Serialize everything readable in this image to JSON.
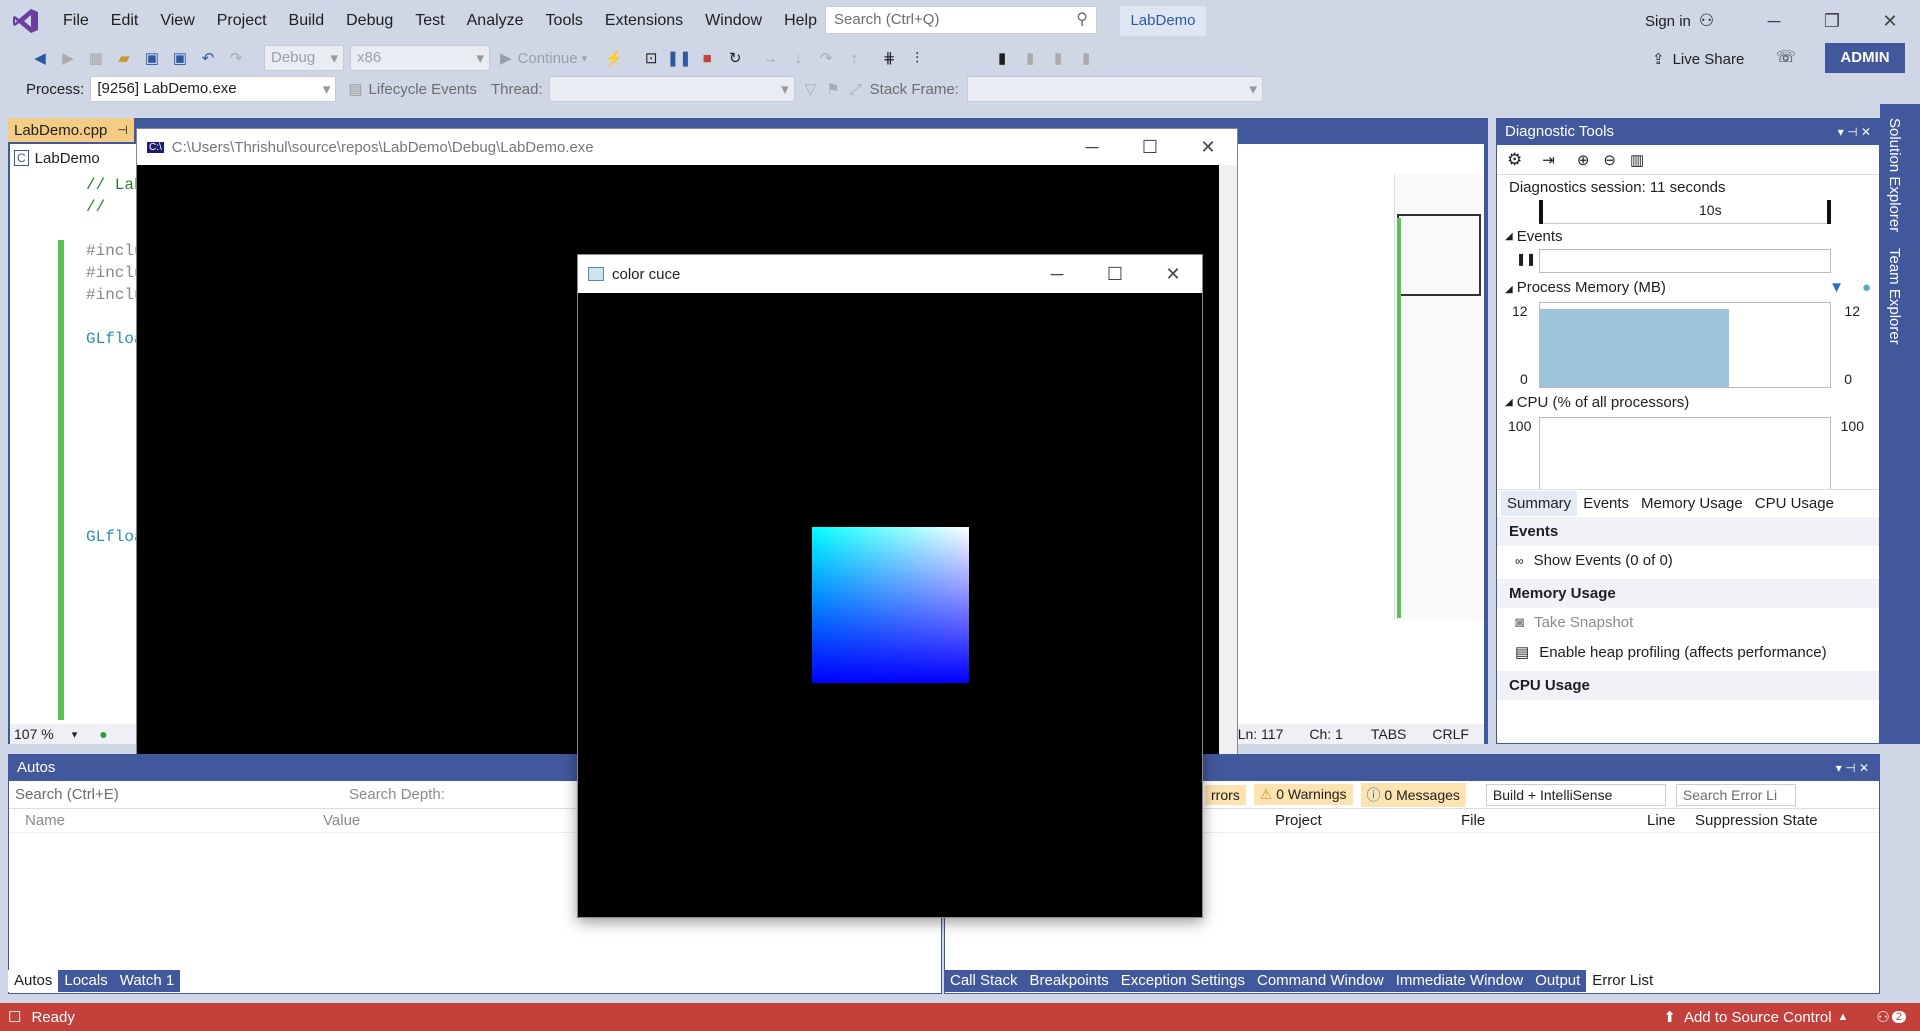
{
  "menu": {
    "items": [
      "File",
      "Edit",
      "View",
      "Project",
      "Build",
      "Debug",
      "Test",
      "Analyze",
      "Tools",
      "Extensions",
      "Window",
      "Help"
    ],
    "search_placeholder": "Search (Ctrl+Q)",
    "solution_name": "LabDemo",
    "sign_in": "Sign in",
    "live_share": "Live Share",
    "admin": "ADMIN"
  },
  "toolbar": {
    "config": "Debug",
    "platform": "x86",
    "continue": "Continue"
  },
  "toolbar2": {
    "process_label": "Process:",
    "process_value": "[9256] LabDemo.exe",
    "lifecycle": "Lifecycle Events",
    "thread_label": "Thread:",
    "stack_label": "Stack Frame:"
  },
  "editor": {
    "tab": "LabDemo.cpp",
    "project": "LabDemo",
    "lines": [
      "// Lab",
      "//",
      "#inclu",
      "#inclu",
      "#inclu",
      "GLfloa",
      "GLfloa"
    ],
    "zoom": "107 %",
    "ln": "Ln: 117",
    "ch": "Ch: 1",
    "tabs": "TABS",
    "eol": "CRLF"
  },
  "console": {
    "title": "C:\\Users\\Thrishul\\source\\repos\\LabDemo\\Debug\\LabDemo.exe"
  },
  "glwindow": {
    "title": "color cuce"
  },
  "diag": {
    "title": "Diagnostic Tools",
    "session": "Diagnostics session: 11 seconds",
    "time_label": "10s",
    "events": "Events",
    "memory": "Process Memory (MB)",
    "mem_max": "12",
    "mem_min": "0",
    "mem_level": 0.65,
    "cpu": "CPU (% of all processors)",
    "cpu_max": "100",
    "tabs": [
      "Summary",
      "Events",
      "Memory Usage",
      "CPU Usage"
    ],
    "sec_events": "Events",
    "show_events": "Show Events (0 of 0)",
    "sec_memory": "Memory Usage",
    "take_snapshot": "Take Snapshot",
    "heap": "Enable heap profiling (affects performance)",
    "sec_cpu": "CPU Usage"
  },
  "autos": {
    "title": "Autos",
    "search_placeholder": "Search (Ctrl+E)",
    "depth": "Search Depth:",
    "col_name": "Name",
    "col_value": "Value",
    "tabs": [
      "Autos",
      "Locals",
      "Watch 1"
    ]
  },
  "errors": {
    "errors": "rrors",
    "warnings": "0 Warnings",
    "messages": "0 Messages",
    "scope": "Build + IntelliSense",
    "search": "Search Error Li",
    "cols": [
      "Project",
      "File",
      "Line",
      "Suppression State"
    ],
    "tabs": [
      "Call Stack",
      "Breakpoints",
      "Exception Settings",
      "Command Window",
      "Immediate Window",
      "Output",
      "Error List"
    ]
  },
  "side": {
    "solution_explorer": "Solution Explorer",
    "team_explorer": "Team Explorer"
  },
  "status": {
    "ready": "Ready",
    "source": "Add to Source Control",
    "count": "2"
  }
}
